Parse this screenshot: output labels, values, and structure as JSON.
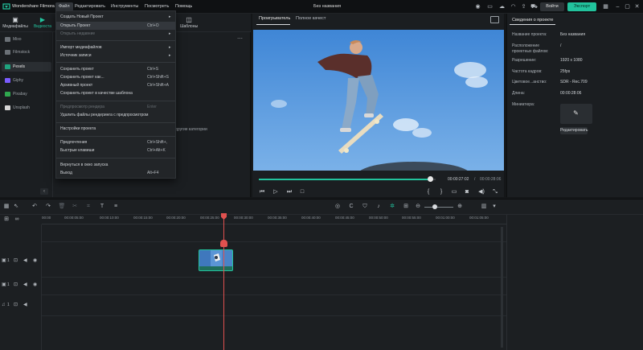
{
  "app": {
    "name": "Wondershare Filmora",
    "title": "Без названия"
  },
  "menubar": [
    "Файл",
    "Редактировать",
    "Инструменты",
    "Посмотреть",
    "Помощь"
  ],
  "topbar": {
    "login": "Войти",
    "export": "Экспорт"
  },
  "left_tabs": [
    "Медиафайлы",
    "Видеоста",
    "Шаблоны"
  ],
  "sidebar": [
    "Mixo",
    "Filmstock",
    "Pexels",
    "Giphy",
    "Pixabay",
    "Unsplash"
  ],
  "lp_snippet": "другие категории",
  "file_menu": [
    {
      "label": "Создать Новый Проект",
      "shortcut": "",
      "arrow": true,
      "disabled": false
    },
    {
      "label": "Открыть Проект",
      "shortcut": "Ctrl+O",
      "arrow": false,
      "disabled": false,
      "highlighted": true
    },
    {
      "label": "Открыть недавние",
      "shortcut": "",
      "arrow": true,
      "disabled": true
    },
    {
      "label": "Импорт медиафайлов",
      "shortcut": "",
      "arrow": true,
      "disabled": false
    },
    {
      "label": "Источник записи",
      "shortcut": "",
      "arrow": true,
      "disabled": false
    },
    {
      "label": "Сохранить проект",
      "shortcut": "Ctrl+S",
      "arrow": false,
      "disabled": false
    },
    {
      "label": "Сохранить проект как...",
      "shortcut": "Ctrl+Shift+S",
      "arrow": false,
      "disabled": false
    },
    {
      "label": "Архивный проект",
      "shortcut": "Ctrl+Shift+A",
      "arrow": false,
      "disabled": false
    },
    {
      "label": "Сохранить проект в качестве шаблона",
      "shortcut": "",
      "arrow": false,
      "disabled": false
    },
    {
      "label": "Предпросмотр рендера",
      "shortcut": "Enter",
      "arrow": false,
      "disabled": true
    },
    {
      "label": "Удалить файлы рендеринга с предпросмотром",
      "shortcut": "",
      "arrow": false,
      "disabled": false
    },
    {
      "label": "Настройки проекта",
      "shortcut": "",
      "arrow": false,
      "disabled": false
    },
    {
      "label": "Предпочтения",
      "shortcut": "Ctrl+Shift+,",
      "arrow": false,
      "disabled": false
    },
    {
      "label": "Быстрые клавиши",
      "shortcut": "Ctrl+Alt+K",
      "arrow": false,
      "disabled": false
    },
    {
      "label": "Вернуться в окно запуска",
      "shortcut": "",
      "arrow": false,
      "disabled": false
    },
    {
      "label": "Выход",
      "shortcut": "Alt+F4",
      "arrow": false,
      "disabled": false
    }
  ],
  "preview": {
    "tab_player": "Проигрыватель",
    "tab_quality": "Полное качест",
    "time_current": "00:00:27:02",
    "time_total": "00:00:28:06",
    "progress": 0.97
  },
  "project_info": {
    "tab": "Сведения о проекте",
    "rows": [
      {
        "label": "Название проекта:",
        "value": "Без названия"
      },
      {
        "label": "Расположение проектных файлов:",
        "value": "/"
      },
      {
        "label": "Разрешение:",
        "value": "1920 x 1080"
      },
      {
        "label": "Частота кадров:",
        "value": "25fps"
      },
      {
        "label": "Цветовое...анство:",
        "value": "SDR - Rec.709"
      },
      {
        "label": "Длина:",
        "value": "00:00:28:06"
      },
      {
        "label": "Миниатюра:",
        "value": ""
      }
    ],
    "edit_button": "Редактировать"
  },
  "timeline": {
    "ruler": [
      "00:00",
      "00:00:05:00",
      "00:00:10:00",
      "00:00:15:00",
      "00:00:20:00",
      "00:00:25:00",
      "00:00:30:00",
      "00:00:35:00",
      "00:00:40:00",
      "00:00:45:00",
      "00:00:50:00",
      "00:00:55:00",
      "00:01:00:00",
      "00:01:05:00"
    ],
    "track_labels": [
      "1",
      "1",
      "1"
    ]
  },
  "colors": {
    "accent": "#22c39d",
    "playhead": "#e0514f",
    "background": "#141618"
  }
}
